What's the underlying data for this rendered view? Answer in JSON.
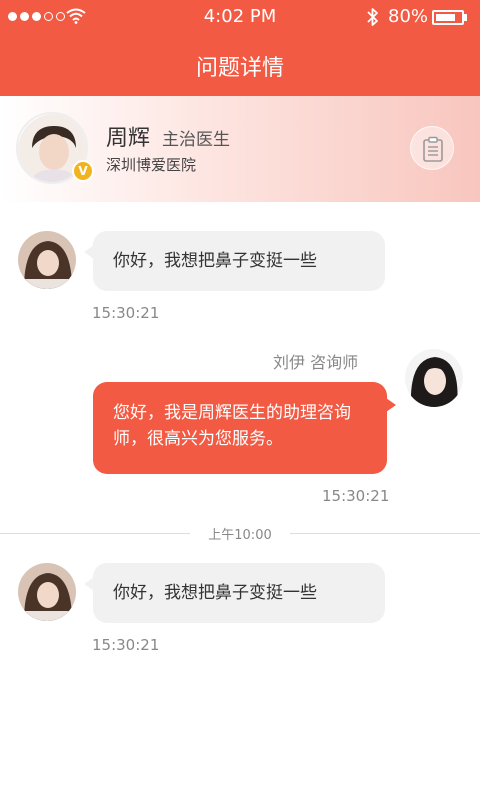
{
  "status_bar": {
    "time": "4:02 PM",
    "battery_percent": "80%",
    "battery_level": 0.8
  },
  "nav": {
    "title": "问题详情"
  },
  "doctor": {
    "name": "周辉",
    "title": "主治医生",
    "hospital": "深圳博爱医院",
    "badge": "V"
  },
  "messages": [
    {
      "side": "left",
      "text": "你好，我想把鼻子变挺一些",
      "time": "15:30:21"
    },
    {
      "side": "right",
      "sender": "刘伊  咨询师",
      "text": "您好，我是周辉医生的助理咨询师，很高兴为您服务。",
      "time": "15:30:21"
    },
    {
      "side": "left",
      "text": "你好，我想把鼻子变挺一些",
      "time": "15:30:21"
    }
  ],
  "divider": {
    "label": "上午10:00"
  },
  "colors": {
    "accent": "#f25a43",
    "badge": "#f2b41e",
    "bubble_in": "#f1f1f1"
  }
}
